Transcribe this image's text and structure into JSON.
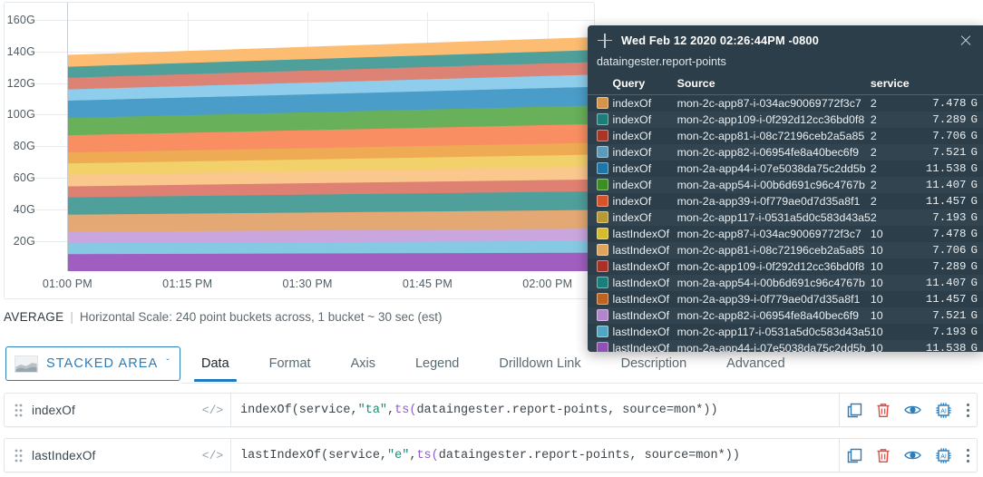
{
  "chart_data": {
    "type": "area",
    "stacked": true,
    "title": "",
    "xlabel": "",
    "ylabel": "",
    "grid": true,
    "ylim": [
      0,
      165
    ],
    "y_unit": "G",
    "yticks": [
      160,
      140,
      120,
      100,
      80,
      60,
      40,
      20
    ],
    "ytick_labels": [
      "160G",
      "140G",
      "120G",
      "100G",
      "80G",
      "60G",
      "40G",
      "20G"
    ],
    "x": [
      "01:00 PM",
      "01:15 PM",
      "01:30 PM",
      "01:45 PM",
      "02:00 PM"
    ],
    "xtick_labels": [
      "01:00 PM",
      "01:15 PM",
      "01:30 PM",
      "01:45 PM",
      "02:00 PM"
    ],
    "cursor_time": "02:26:44PM",
    "series": [
      {
        "name": "lastIndexOf mon-2a-app44-i-07e5038da75c2dd5b",
        "color": "#a05fc0",
        "start": 11.0,
        "end": 11.9
      },
      {
        "name": "lastIndexOf mon-2c-app117-i-0531a5d0c583d43a5",
        "color": "#86c9e3",
        "start": 6.9,
        "end": 7.5
      },
      {
        "name": "lastIndexOf mon-2c-app82-i-06954fe8a40bec6f9",
        "color": "#c9a6dd",
        "start": 7.2,
        "end": 7.8
      },
      {
        "name": "lastIndexOf mon-2a-app39-i-0f779ae0d7d35a8f1",
        "color": "#e3a873",
        "start": 11.0,
        "end": 11.9
      },
      {
        "name": "lastIndexOf mon-2a-app54-i-00b6d691c96c4767b",
        "color": "#4f9f9a",
        "start": 11.0,
        "end": 11.8
      },
      {
        "name": "lastIndexOf mon-2c-app109-i-0f292d12cc36bd0f8",
        "color": "#de8173",
        "start": 7.0,
        "end": 7.6
      },
      {
        "name": "lastIndexOf mon-2c-app81-i-08c72196ceb2a5a85",
        "color": "#fac78c",
        "start": 7.4,
        "end": 8.0
      },
      {
        "name": "lastIndexOf mon-2c-app87-i-034ac90069772f3c7",
        "color": "#f2d06a",
        "start": 7.2,
        "end": 7.8
      },
      {
        "name": "indexOf mon-2c-app117-i-0531a5d0c583d43a5",
        "color": "#eeab53",
        "start": 6.9,
        "end": 7.5
      },
      {
        "name": "indexOf mon-2a-app39-i-0f779ae0d7d35a8f1",
        "color": "#f98e63",
        "start": 11.0,
        "end": 11.9
      },
      {
        "name": "indexOf mon-2a-app54-i-00b6d691c96c4767b",
        "color": "#68b05a",
        "start": 11.0,
        "end": 11.8
      },
      {
        "name": "indexOf mon-2a-app44-i-07e5038da75c2dd5b",
        "color": "#4a9dc9",
        "start": 11.0,
        "end": 11.9
      },
      {
        "name": "indexOf mon-2c-app82-i-06954fe8a40bec6f9",
        "color": "#8ecdeb",
        "start": 7.2,
        "end": 7.8
      },
      {
        "name": "indexOf mon-2c-app81-i-08c72196ceb2a5a85",
        "color": "#dd8376",
        "start": 7.4,
        "end": 8.0
      },
      {
        "name": "indexOf mon-2c-app109-i-0f292d12cc36bd0f8",
        "color": "#4f9f9a",
        "start": 7.0,
        "end": 7.6
      },
      {
        "name": "indexOf mon-2c-app87-i-034ac90069772f3c7",
        "color": "#fcbd72",
        "start": 7.2,
        "end": 7.9
      }
    ]
  },
  "scale_bar": {
    "aggregation": "AVERAGE",
    "separator": "|",
    "description": "Horizontal Scale: 240 point buckets across, 1 bucket ~ 30 sec (est)"
  },
  "chart_type_selector": {
    "label": "STACKED AREA",
    "caret": "ˇ",
    "icon": "stacked-area-thumbnail"
  },
  "tabs": [
    {
      "label": "Data",
      "active": true
    },
    {
      "label": "Format",
      "active": false
    },
    {
      "label": "Axis",
      "active": false
    },
    {
      "label": "Legend",
      "active": false
    },
    {
      "label": "Drilldown Link",
      "active": false
    },
    {
      "label": "Description",
      "active": false
    },
    {
      "label": "Advanced",
      "active": false
    }
  ],
  "queries": [
    {
      "name": "indexOf",
      "code_toggle": "</>",
      "expr_prefix": "indexOf(service, ",
      "expr_string": "\"ta\"",
      "expr_mid": ", ",
      "expr_fn": "ts(",
      "expr_suffix": "dataingester.report-points, source=mon*))",
      "expr_full": "indexOf(service, \"ta\", ts(dataingester.report-points, source=mon*))"
    },
    {
      "name": "lastIndexOf",
      "code_toggle": "</>",
      "expr_prefix": "lastIndexOf(service, ",
      "expr_string": "\"e\"",
      "expr_mid": ", ",
      "expr_fn": "ts(",
      "expr_suffix": "dataingester.report-points, source=mon*))",
      "expr_full": "lastIndexOf(service, \"e\", ts(dataingester.report-points, source=mon*))"
    }
  ],
  "row_actions": [
    {
      "icon": "clone-icon",
      "color": "#2b7cb9"
    },
    {
      "icon": "trash-icon",
      "color": "#e8483f"
    },
    {
      "icon": "eye-icon",
      "color": "#2b7cb9"
    },
    {
      "icon": "ai-chip-icon",
      "color": "#2b7cb9"
    },
    {
      "icon": "kebab-menu-icon",
      "color": "#5c6a72"
    }
  ],
  "tooltip": {
    "pin_icon": "plus-icon",
    "close_icon": "close-icon",
    "timestamp": "Wed Feb 12 2020 02:26:44PM -0800",
    "metric": "dataingester.report-points",
    "columns": [
      "",
      "Query",
      "Source",
      "service",
      "",
      ""
    ],
    "rows": [
      {
        "color": "#d69449",
        "query": "indexOf",
        "source": "mon-2c-app87-i-034ac90069772f3c7",
        "service": "2",
        "value": "7.478",
        "unit": "G"
      },
      {
        "color": "#1b7f79",
        "query": "indexOf",
        "source": "mon-2c-app109-i-0f292d12cc36bd0f8",
        "service": "2",
        "value": "7.289",
        "unit": "G"
      },
      {
        "color": "#a93527",
        "query": "indexOf",
        "source": "mon-2c-app81-i-08c72196ceb2a5a85",
        "service": "2",
        "value": "7.706",
        "unit": "G"
      },
      {
        "color": "#5b9cba",
        "query": "indexOf",
        "source": "mon-2c-app82-i-06954fe8a40bec6f9",
        "service": "2",
        "value": "7.521",
        "unit": "G"
      },
      {
        "color": "#1d76a8",
        "query": "indexOf",
        "source": "mon-2a-app44-i-07e5038da75c2dd5b",
        "service": "2",
        "value": "11.538",
        "unit": "G"
      },
      {
        "color": "#3a8f23",
        "query": "indexOf",
        "source": "mon-2a-app54-i-00b6d691c96c4767b",
        "service": "2",
        "value": "11.407",
        "unit": "G"
      },
      {
        "color": "#d9532a",
        "query": "indexOf",
        "source": "mon-2a-app39-i-0f779ae0d7d35a8f1",
        "service": "2",
        "value": "11.457",
        "unit": "G"
      },
      {
        "color": "#b89a33",
        "query": "indexOf",
        "source": "mon-2c-app117-i-0531a5d0c583d43a5",
        "service": "2",
        "value": "7.193",
        "unit": "G"
      },
      {
        "color": "#d4bc2e",
        "query": "lastIndexOf",
        "source": "mon-2c-app87-i-034ac90069772f3c7",
        "service": "10",
        "value": "7.478",
        "unit": "G"
      },
      {
        "color": "#e0a45a",
        "query": "lastIndexOf",
        "source": "mon-2c-app81-i-08c72196ceb2a5a85",
        "service": "10",
        "value": "7.706",
        "unit": "G"
      },
      {
        "color": "#a93026",
        "query": "lastIndexOf",
        "source": "mon-2c-app109-i-0f292d12cc36bd0f8",
        "service": "10",
        "value": "7.289",
        "unit": "G"
      },
      {
        "color": "#17807c",
        "query": "lastIndexOf",
        "source": "mon-2a-app54-i-00b6d691c96c4767b",
        "service": "10",
        "value": "11.407",
        "unit": "G"
      },
      {
        "color": "#bf6420",
        "query": "lastIndexOf",
        "source": "mon-2a-app39-i-0f779ae0d7d35a8f1",
        "service": "10",
        "value": "11.457",
        "unit": "G"
      },
      {
        "color": "#b385cc",
        "query": "lastIndexOf",
        "source": "mon-2c-app82-i-06954fe8a40bec6f9",
        "service": "10",
        "value": "7.521",
        "unit": "G"
      },
      {
        "color": "#4fa7c4",
        "query": "lastIndexOf",
        "source": "mon-2c-app117-i-0531a5d0c583d43a5",
        "service": "10",
        "value": "7.193",
        "unit": "G"
      },
      {
        "color": "#8e52b5",
        "query": "lastIndexOf",
        "source": "mon-2a-app44-i-07e5038da75c2dd5b",
        "service": "10",
        "value": "11.538",
        "unit": "G"
      }
    ]
  }
}
